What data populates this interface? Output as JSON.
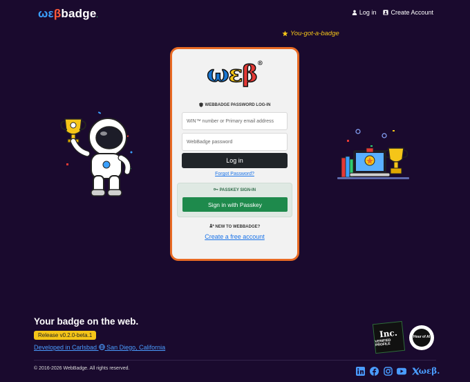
{
  "header": {
    "logo": {
      "part1": "ωε",
      "part2": "β",
      "part3": "badge",
      "dot": "."
    },
    "nav": {
      "login": "Log in",
      "create_account": "Create Account"
    }
  },
  "banner": {
    "you_got_badge": "You-got-a-badge"
  },
  "card": {
    "brand": {
      "w": "ω",
      "e": "ε",
      "b": "β",
      "reg": "®"
    },
    "password_section": "WEBBADGE PASSWORD LOG-IN",
    "win_placeholder": "WIN™ number or Primary email address",
    "password_placeholder": "WebBadge password",
    "login_button": "Log in",
    "forgot_password": "Forgot Password?",
    "passkey_section": "PASSKEY SIGN-IN",
    "passkey_button": "Sign in with Passkey",
    "new_section": "NEW TO WEBBADGE?",
    "create_link": "Create a free account"
  },
  "footer": {
    "tagline": "Your badge on the web.",
    "release": "Release v0.2.0-beta.1",
    "developed_prefix": "Developed in Carlsbad",
    "developed_suffix": "San Diego, California",
    "inc_title": "Inc.",
    "inc_sub": "VERIFIED PROFILE",
    "hour_badge": "Hour of AI",
    "copyright": "© 2016-2026 WebBadge. All rights reserved.",
    "social_wb": "ωεβ."
  },
  "colors": {
    "background": "#1a0a2e",
    "card_border": "#e86a24",
    "accent_yellow": "#f5c518",
    "passkey_green": "#1e8a4c",
    "link_blue": "#1a73e8"
  },
  "icons": [
    "user-icon",
    "id-card-icon",
    "star-icon",
    "shield-icon",
    "key-icon",
    "user-plus-icon",
    "globe-icon",
    "linkedin-icon",
    "facebook-icon",
    "instagram-icon",
    "youtube-icon",
    "x-icon"
  ]
}
